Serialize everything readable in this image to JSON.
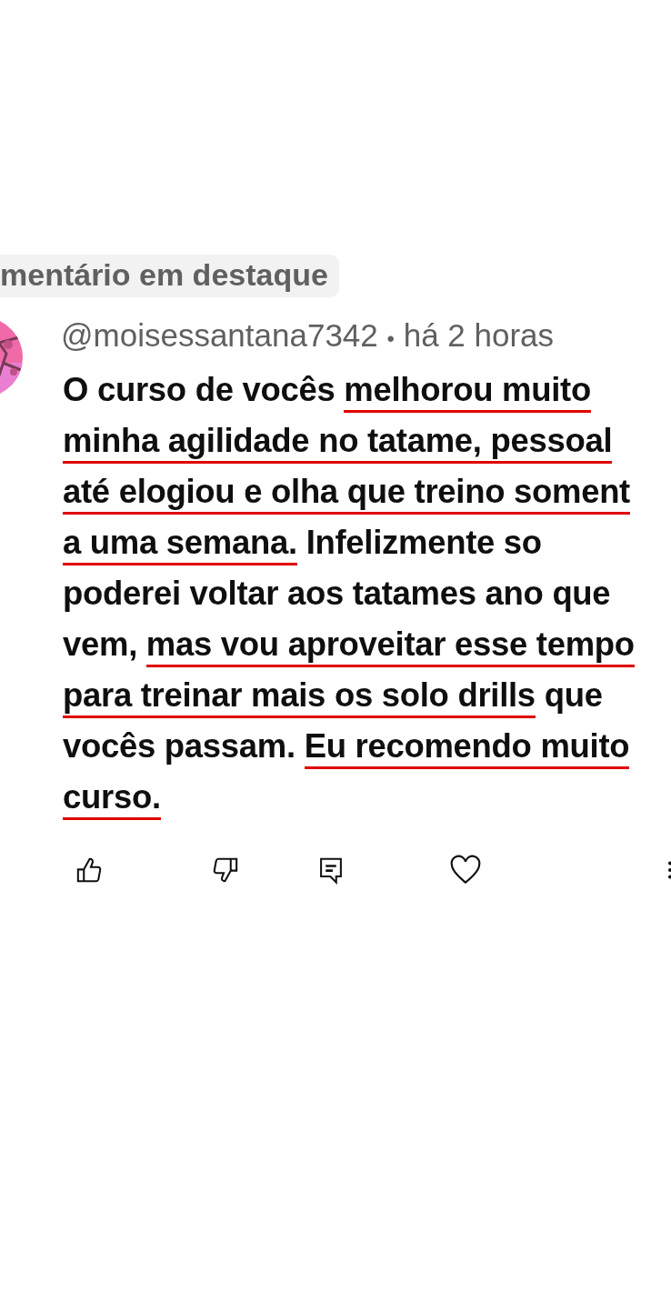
{
  "badge": {
    "label": "mentário em destaque"
  },
  "comment": {
    "author": "@moisessantana7342",
    "separator": "•",
    "time": "há 2 horas",
    "lines": [
      [
        {
          "text": "O curso de vocês ",
          "underlined": false
        },
        {
          "text": "melhorou muito ",
          "underlined": true
        }
      ],
      [
        {
          "text": "minha agilidade no tatame, pessoal",
          "underlined": true
        }
      ],
      [
        {
          "text": "até elogiou e olha que treino soment",
          "underlined": true
        }
      ],
      [
        {
          "text": "a uma semana.",
          "underlined": true
        },
        {
          "text": " Infelizmente so",
          "underlined": false
        }
      ],
      [
        {
          "text": "poderei voltar aos tatames ano que",
          "underlined": false
        }
      ],
      [
        {
          "text": "vem, ",
          "underlined": false
        },
        {
          "text": "mas vou aproveitar esse tempo",
          "underlined": true
        }
      ],
      [
        {
          "text": "para treinar mais os solo drills",
          "underlined": true
        },
        {
          "text": " que",
          "underlined": false
        }
      ],
      [
        {
          "text": "vocês passam. ",
          "underlined": false
        },
        {
          "text": "Eu recomendo muito",
          "underlined": true
        }
      ],
      [
        {
          "text": "curso.",
          "underlined": true
        }
      ]
    ]
  },
  "actions": [
    {
      "kind": "like"
    },
    {
      "kind": "dislike"
    },
    {
      "kind": "reply"
    },
    {
      "kind": "heart"
    },
    {
      "kind": "more"
    }
  ]
}
